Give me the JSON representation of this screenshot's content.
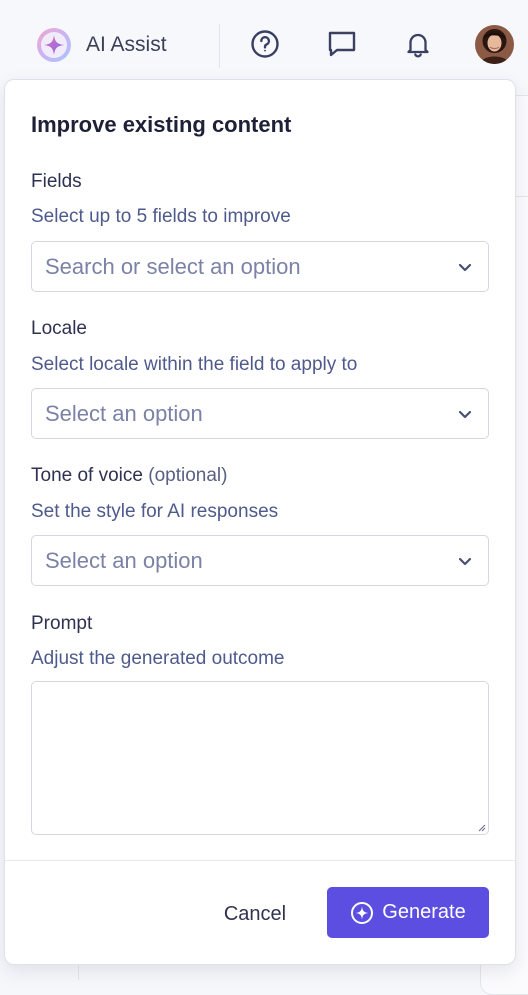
{
  "topbar": {
    "ai_assist_label": "AI Assist",
    "icons": [
      "help-icon",
      "chat-icon",
      "bell-icon"
    ]
  },
  "panel": {
    "title": "Improve existing content",
    "fields": {
      "label": "Fields",
      "help": "Select up to 5 fields to improve",
      "placeholder": "Search or select an option"
    },
    "locale": {
      "label": "Locale",
      "help": "Select locale within the field to apply to",
      "placeholder": "Select an option"
    },
    "tone": {
      "label": "Tone of voice",
      "optional": "(optional)",
      "help": "Set the style for AI responses",
      "placeholder": "Select an option"
    },
    "prompt": {
      "label": "Prompt",
      "help": "Adjust the generated outcome",
      "value": ""
    },
    "cancel_label": "Cancel",
    "generate_label": "Generate"
  },
  "colors": {
    "primary": "#5b4ee0",
    "help_text": "#4f5a8c",
    "placeholder": "#7b82a6",
    "border": "#d4d7e3"
  }
}
